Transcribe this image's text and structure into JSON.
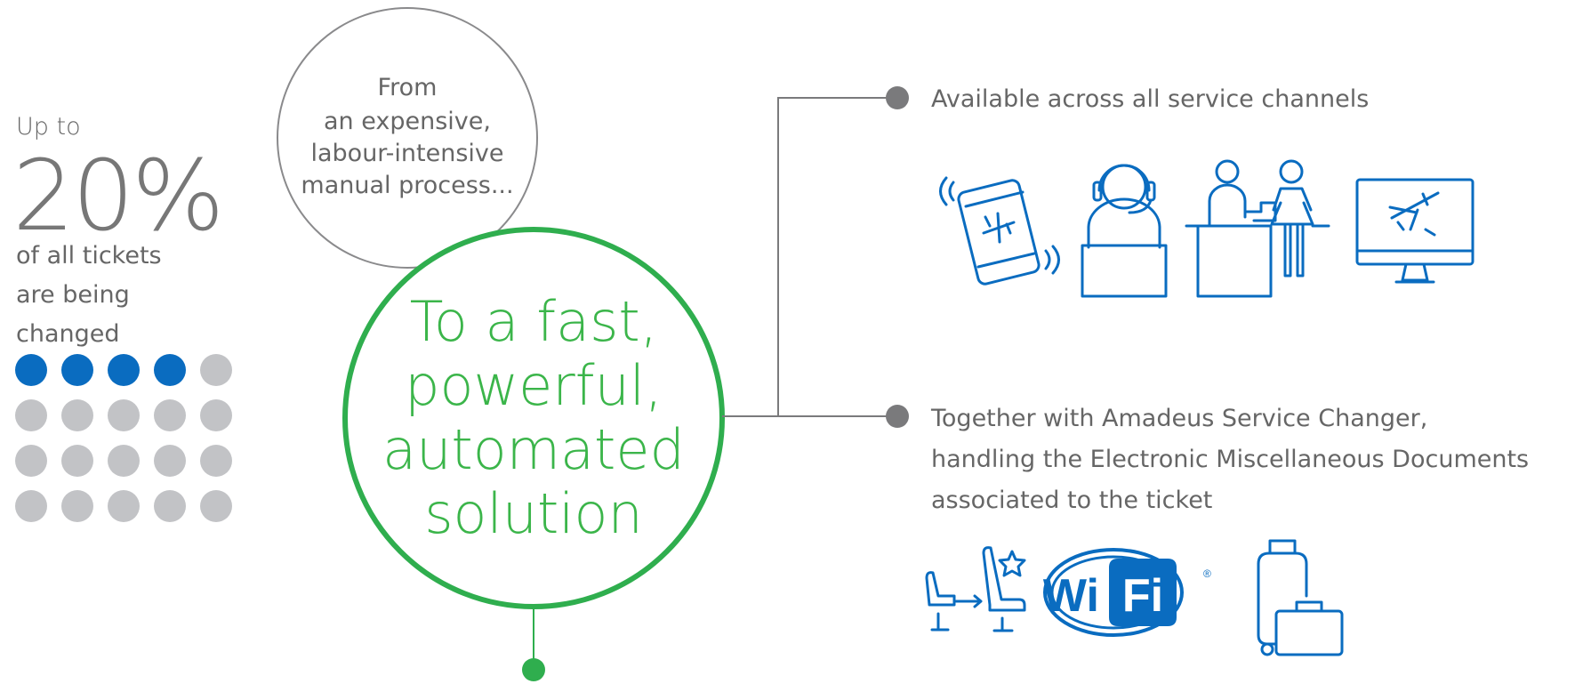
{
  "stat": {
    "prefix": "Up to",
    "value": "20%",
    "desc_lines": [
      "of all tickets",
      "are being",
      "changed"
    ],
    "dots_total": 20,
    "dots_active": 4
  },
  "from_circle": {
    "lines": [
      "From",
      "an expensive,",
      "labour-intensive",
      "manual process..."
    ]
  },
  "main_circle": {
    "lines": [
      "To a fast,",
      "powerful,",
      "automated",
      "solution"
    ]
  },
  "bullets": [
    {
      "lines": [
        "Available across all service channels"
      ]
    },
    {
      "lines": [
        "Together with Amadeus Service Changer,",
        "handling the Electronic Miscellaneous Documents",
        "associated to the ticket"
      ]
    }
  ],
  "icons": {
    "channels": [
      "mobile-plane-icon",
      "call-center-agent-icon",
      "airport-counter-icon",
      "desktop-plane-icon"
    ],
    "services": [
      "seat-upgrade-icon",
      "wifi-icon",
      "baggage-icon"
    ],
    "wifi_left": "Wi",
    "wifi_right": "Fi",
    "wifi_mark": "®"
  },
  "colors": {
    "blue": "#0a6cc0",
    "green": "#2fae4e",
    "gray_dot": "#c2c3c6",
    "text_gray": "#666666",
    "connector": "#7a7a7c"
  }
}
